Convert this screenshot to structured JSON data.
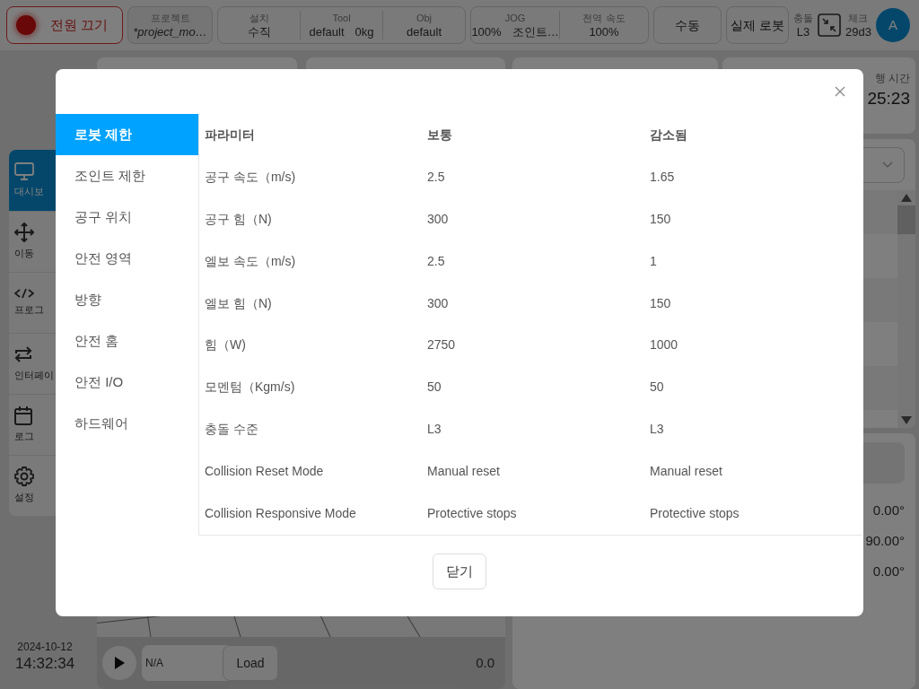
{
  "top_bar": {
    "power_button": "전원 끄기",
    "project": {
      "label": "프로젝트",
      "value": "*project_mo…"
    },
    "install": [
      {
        "label": "설치",
        "value": "수직"
      },
      {
        "label": "Tool",
        "value": "default",
        "weight": "0kg"
      },
      {
        "label": "Obj",
        "value": "default"
      }
    ],
    "jog": [
      {
        "label": "JOG",
        "value": "100%",
        "mode": "조인트…"
      },
      {
        "label": "전역 속도",
        "value": "100%"
      }
    ],
    "mode_button": "수동",
    "robot_button": "실제 로봇",
    "collision": {
      "label": "충돌",
      "value": "L3"
    },
    "check": {
      "label": "체크",
      "value": "29d3"
    },
    "avatar": "A"
  },
  "sidebar": {
    "items": [
      {
        "label": "대시보",
        "selected": true
      },
      {
        "label": "이동",
        "selected": false
      },
      {
        "label": "프로그",
        "selected": false
      },
      {
        "label": "인터페이",
        "selected": false
      },
      {
        "label": "로그",
        "selected": false
      },
      {
        "label": "설정",
        "selected": false
      }
    ]
  },
  "run_time": {
    "label": "행 시간",
    "value": "25:23"
  },
  "angles": [
    "0.00°",
    "90.00°",
    "0.00°"
  ],
  "clock": {
    "date": "2024-10-12",
    "time": "14:32:34"
  },
  "player": {
    "program": "N/A",
    "load_button": "Load",
    "value": "0.0"
  },
  "dialog": {
    "tabs": [
      {
        "label": "로봇 제한",
        "selected": true
      },
      {
        "label": "조인트 제한",
        "selected": false
      },
      {
        "label": "공구 위치",
        "selected": false
      },
      {
        "label": "안전 영역",
        "selected": false
      },
      {
        "label": "방향",
        "selected": false
      },
      {
        "label": "안전 홈",
        "selected": false
      },
      {
        "label": "안전 I/O",
        "selected": false
      },
      {
        "label": "하드웨어",
        "selected": false
      }
    ],
    "table": {
      "columns": [
        "파라미터",
        "보통",
        "감소됨"
      ],
      "rows": [
        [
          "공구 속도（m/s)",
          "2.5",
          "1.65"
        ],
        [
          "공구 힘（N)",
          "300",
          "150"
        ],
        [
          "엘보 속도（m/s)",
          "2.5",
          "1"
        ],
        [
          "엘보 힘（N)",
          "300",
          "150"
        ],
        [
          "힘（W)",
          "2750",
          "1000"
        ],
        [
          "모멘텀（Kgm/s)",
          "50",
          "50"
        ],
        [
          "충돌 수준",
          "L3",
          "L3"
        ],
        [
          "Collision Reset Mode",
          "Manual reset",
          "Manual reset"
        ],
        [
          "Collision Responsive Mode",
          "Protective stops",
          "Protective stops"
        ]
      ]
    },
    "close_button": "닫기"
  }
}
